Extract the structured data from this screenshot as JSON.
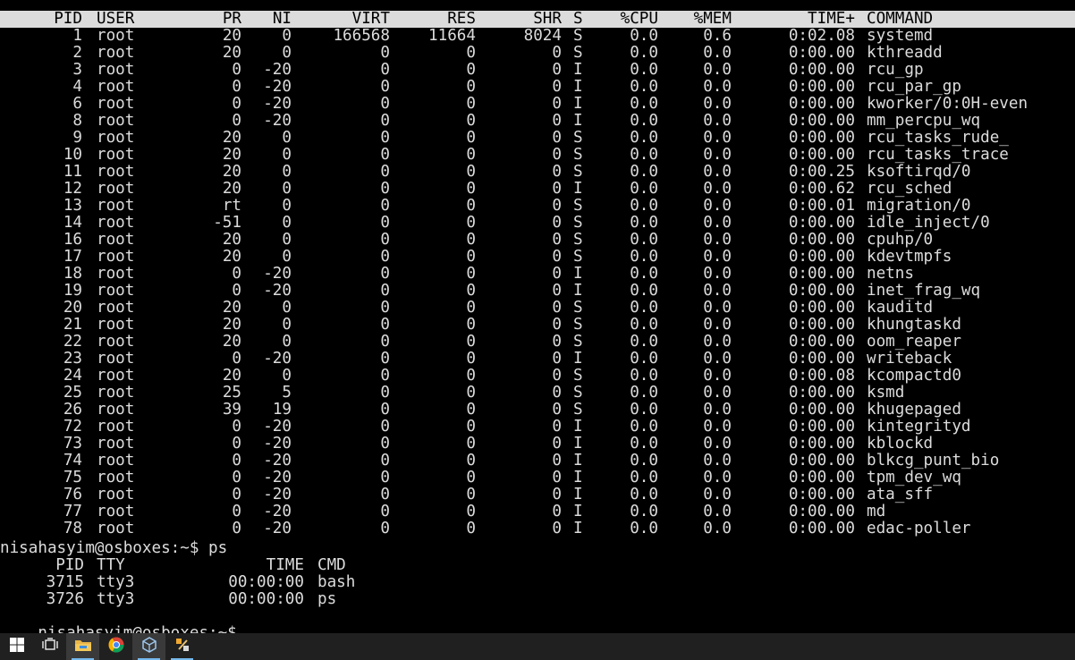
{
  "top_header": {
    "pid": "PID",
    "user": "USER",
    "pr": "PR",
    "ni": "NI",
    "virt": "VIRT",
    "res": "RES",
    "shr": "SHR",
    "s": "S",
    "cpu": "%CPU",
    "mem": "%MEM",
    "time": "TIME+",
    "command": "COMMAND"
  },
  "processes": [
    {
      "pid": "1",
      "user": "root",
      "pr": "20",
      "ni": "0",
      "virt": "166568",
      "res": "11664",
      "shr": "8024",
      "s": "S",
      "cpu": "0.0",
      "mem": "0.6",
      "time": "0:02.08",
      "command": "systemd"
    },
    {
      "pid": "2",
      "user": "root",
      "pr": "20",
      "ni": "0",
      "virt": "0",
      "res": "0",
      "shr": "0",
      "s": "S",
      "cpu": "0.0",
      "mem": "0.0",
      "time": "0:00.00",
      "command": "kthreadd"
    },
    {
      "pid": "3",
      "user": "root",
      "pr": "0",
      "ni": "-20",
      "virt": "0",
      "res": "0",
      "shr": "0",
      "s": "I",
      "cpu": "0.0",
      "mem": "0.0",
      "time": "0:00.00",
      "command": "rcu_gp"
    },
    {
      "pid": "4",
      "user": "root",
      "pr": "0",
      "ni": "-20",
      "virt": "0",
      "res": "0",
      "shr": "0",
      "s": "I",
      "cpu": "0.0",
      "mem": "0.0",
      "time": "0:00.00",
      "command": "rcu_par_gp"
    },
    {
      "pid": "6",
      "user": "root",
      "pr": "0",
      "ni": "-20",
      "virt": "0",
      "res": "0",
      "shr": "0",
      "s": "I",
      "cpu": "0.0",
      "mem": "0.0",
      "time": "0:00.00",
      "command": "kworker/0:0H-even"
    },
    {
      "pid": "8",
      "user": "root",
      "pr": "0",
      "ni": "-20",
      "virt": "0",
      "res": "0",
      "shr": "0",
      "s": "I",
      "cpu": "0.0",
      "mem": "0.0",
      "time": "0:00.00",
      "command": "mm_percpu_wq"
    },
    {
      "pid": "9",
      "user": "root",
      "pr": "20",
      "ni": "0",
      "virt": "0",
      "res": "0",
      "shr": "0",
      "s": "S",
      "cpu": "0.0",
      "mem": "0.0",
      "time": "0:00.00",
      "command": "rcu_tasks_rude_"
    },
    {
      "pid": "10",
      "user": "root",
      "pr": "20",
      "ni": "0",
      "virt": "0",
      "res": "0",
      "shr": "0",
      "s": "S",
      "cpu": "0.0",
      "mem": "0.0",
      "time": "0:00.00",
      "command": "rcu_tasks_trace"
    },
    {
      "pid": "11",
      "user": "root",
      "pr": "20",
      "ni": "0",
      "virt": "0",
      "res": "0",
      "shr": "0",
      "s": "S",
      "cpu": "0.0",
      "mem": "0.0",
      "time": "0:00.25",
      "command": "ksoftirqd/0"
    },
    {
      "pid": "12",
      "user": "root",
      "pr": "20",
      "ni": "0",
      "virt": "0",
      "res": "0",
      "shr": "0",
      "s": "I",
      "cpu": "0.0",
      "mem": "0.0",
      "time": "0:00.62",
      "command": "rcu_sched"
    },
    {
      "pid": "13",
      "user": "root",
      "pr": "rt",
      "ni": "0",
      "virt": "0",
      "res": "0",
      "shr": "0",
      "s": "S",
      "cpu": "0.0",
      "mem": "0.0",
      "time": "0:00.01",
      "command": "migration/0"
    },
    {
      "pid": "14",
      "user": "root",
      "pr": "-51",
      "ni": "0",
      "virt": "0",
      "res": "0",
      "shr": "0",
      "s": "S",
      "cpu": "0.0",
      "mem": "0.0",
      "time": "0:00.00",
      "command": "idle_inject/0"
    },
    {
      "pid": "16",
      "user": "root",
      "pr": "20",
      "ni": "0",
      "virt": "0",
      "res": "0",
      "shr": "0",
      "s": "S",
      "cpu": "0.0",
      "mem": "0.0",
      "time": "0:00.00",
      "command": "cpuhp/0"
    },
    {
      "pid": "17",
      "user": "root",
      "pr": "20",
      "ni": "0",
      "virt": "0",
      "res": "0",
      "shr": "0",
      "s": "S",
      "cpu": "0.0",
      "mem": "0.0",
      "time": "0:00.00",
      "command": "kdevtmpfs"
    },
    {
      "pid": "18",
      "user": "root",
      "pr": "0",
      "ni": "-20",
      "virt": "0",
      "res": "0",
      "shr": "0",
      "s": "I",
      "cpu": "0.0",
      "mem": "0.0",
      "time": "0:00.00",
      "command": "netns"
    },
    {
      "pid": "19",
      "user": "root",
      "pr": "0",
      "ni": "-20",
      "virt": "0",
      "res": "0",
      "shr": "0",
      "s": "I",
      "cpu": "0.0",
      "mem": "0.0",
      "time": "0:00.00",
      "command": "inet_frag_wq"
    },
    {
      "pid": "20",
      "user": "root",
      "pr": "20",
      "ni": "0",
      "virt": "0",
      "res": "0",
      "shr": "0",
      "s": "S",
      "cpu": "0.0",
      "mem": "0.0",
      "time": "0:00.00",
      "command": "kauditd"
    },
    {
      "pid": "21",
      "user": "root",
      "pr": "20",
      "ni": "0",
      "virt": "0",
      "res": "0",
      "shr": "0",
      "s": "S",
      "cpu": "0.0",
      "mem": "0.0",
      "time": "0:00.00",
      "command": "khungtaskd"
    },
    {
      "pid": "22",
      "user": "root",
      "pr": "20",
      "ni": "0",
      "virt": "0",
      "res": "0",
      "shr": "0",
      "s": "S",
      "cpu": "0.0",
      "mem": "0.0",
      "time": "0:00.00",
      "command": "oom_reaper"
    },
    {
      "pid": "23",
      "user": "root",
      "pr": "0",
      "ni": "-20",
      "virt": "0",
      "res": "0",
      "shr": "0",
      "s": "I",
      "cpu": "0.0",
      "mem": "0.0",
      "time": "0:00.00",
      "command": "writeback"
    },
    {
      "pid": "24",
      "user": "root",
      "pr": "20",
      "ni": "0",
      "virt": "0",
      "res": "0",
      "shr": "0",
      "s": "S",
      "cpu": "0.0",
      "mem": "0.0",
      "time": "0:00.08",
      "command": "kcompactd0"
    },
    {
      "pid": "25",
      "user": "root",
      "pr": "25",
      "ni": "5",
      "virt": "0",
      "res": "0",
      "shr": "0",
      "s": "S",
      "cpu": "0.0",
      "mem": "0.0",
      "time": "0:00.00",
      "command": "ksmd"
    },
    {
      "pid": "26",
      "user": "root",
      "pr": "39",
      "ni": "19",
      "virt": "0",
      "res": "0",
      "shr": "0",
      "s": "S",
      "cpu": "0.0",
      "mem": "0.0",
      "time": "0:00.00",
      "command": "khugepaged"
    },
    {
      "pid": "72",
      "user": "root",
      "pr": "0",
      "ni": "-20",
      "virt": "0",
      "res": "0",
      "shr": "0",
      "s": "I",
      "cpu": "0.0",
      "mem": "0.0",
      "time": "0:00.00",
      "command": "kintegrityd"
    },
    {
      "pid": "73",
      "user": "root",
      "pr": "0",
      "ni": "-20",
      "virt": "0",
      "res": "0",
      "shr": "0",
      "s": "I",
      "cpu": "0.0",
      "mem": "0.0",
      "time": "0:00.00",
      "command": "kblockd"
    },
    {
      "pid": "74",
      "user": "root",
      "pr": "0",
      "ni": "-20",
      "virt": "0",
      "res": "0",
      "shr": "0",
      "s": "I",
      "cpu": "0.0",
      "mem": "0.0",
      "time": "0:00.00",
      "command": "blkcg_punt_bio"
    },
    {
      "pid": "75",
      "user": "root",
      "pr": "0",
      "ni": "-20",
      "virt": "0",
      "res": "0",
      "shr": "0",
      "s": "I",
      "cpu": "0.0",
      "mem": "0.0",
      "time": "0:00.00",
      "command": "tpm_dev_wq"
    },
    {
      "pid": "76",
      "user": "root",
      "pr": "0",
      "ni": "-20",
      "virt": "0",
      "res": "0",
      "shr": "0",
      "s": "I",
      "cpu": "0.0",
      "mem": "0.0",
      "time": "0:00.00",
      "command": "ata_sff"
    },
    {
      "pid": "77",
      "user": "root",
      "pr": "0",
      "ni": "-20",
      "virt": "0",
      "res": "0",
      "shr": "0",
      "s": "I",
      "cpu": "0.0",
      "mem": "0.0",
      "time": "0:00.00",
      "command": "md"
    },
    {
      "pid": "78",
      "user": "root",
      "pr": "0",
      "ni": "-20",
      "virt": "0",
      "res": "0",
      "shr": "0",
      "s": "I",
      "cpu": "0.0",
      "mem": "0.0",
      "time": "0:00.00",
      "command": "edac-poller"
    }
  ],
  "prompt_line_1": "nisahasyim@osboxes:~$ ps",
  "ps_header": {
    "pid": "PID",
    "tty": "TTY",
    "time": "TIME",
    "cmd": "CMD"
  },
  "ps_rows": [
    {
      "pid": "3715",
      "tty": "tty3",
      "time": "00:00:00",
      "cmd": "bash"
    },
    {
      "pid": "3726",
      "tty": "tty3",
      "time": "00:00:00",
      "cmd": "ps"
    }
  ],
  "prompt_line_2": "nisahasyim@osboxes:~$ ",
  "taskbar": {
    "items": [
      {
        "icon": "windows-start-icon"
      },
      {
        "icon": "task-view-icon"
      },
      {
        "icon": "file-explorer-icon"
      },
      {
        "icon": "chrome-icon"
      },
      {
        "icon": "virtualbox-icon"
      },
      {
        "icon": "tools-app-icon"
      }
    ],
    "colors": {
      "background": "#202020",
      "accent": "#76b9ed",
      "terminal_text": "#dcdcdc"
    }
  }
}
